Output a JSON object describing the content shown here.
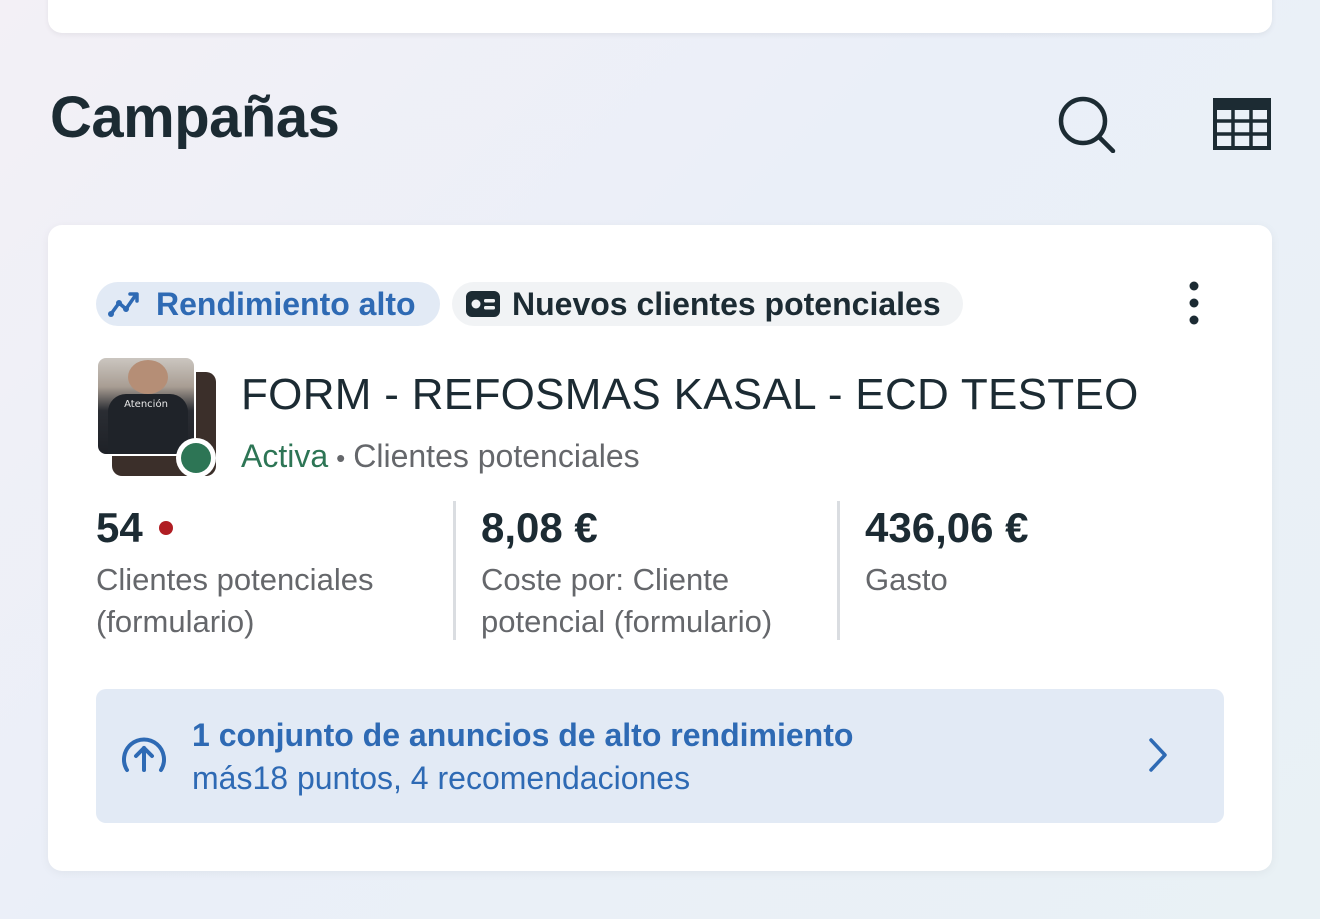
{
  "section": {
    "title": "Campañas",
    "search_icon": "search-icon",
    "table_icon": "table-view-icon"
  },
  "campaign": {
    "badges": {
      "performance": "Rendimiento alto",
      "performance_icon": "trend-up-icon",
      "objective": "Nuevos clientes potenciales",
      "objective_icon": "lead-form-icon"
    },
    "thumbnail_text": "Atención",
    "name": "FORM - REFOSMAS KASAL - ECD TESTEO",
    "status": "Activa",
    "separator": "•",
    "type": "Clientes potenciales",
    "metrics": [
      {
        "value": "54",
        "label_line1": "Clientes potenciales",
        "label_line2": "(formulario)",
        "alert": true
      },
      {
        "value": "8,08 €",
        "label_line1": "Coste por: Cliente",
        "label_line2": "potencial (formulario)"
      },
      {
        "value": "436,06 €",
        "label_line1": "Gasto",
        "label_line2": ""
      }
    ],
    "recommendation": {
      "title": "1 conjunto de anuncios de alto rendimiento",
      "subtitle": "más18 puntos, 4 recomendaciones",
      "icon": "arrow-up-circle-icon"
    }
  },
  "colors": {
    "accent_blue": "#2e6ab4",
    "active_green": "#2d7555",
    "alert_red": "#b01d23",
    "text_primary": "#1c2b33",
    "text_secondary": "#65676b"
  }
}
